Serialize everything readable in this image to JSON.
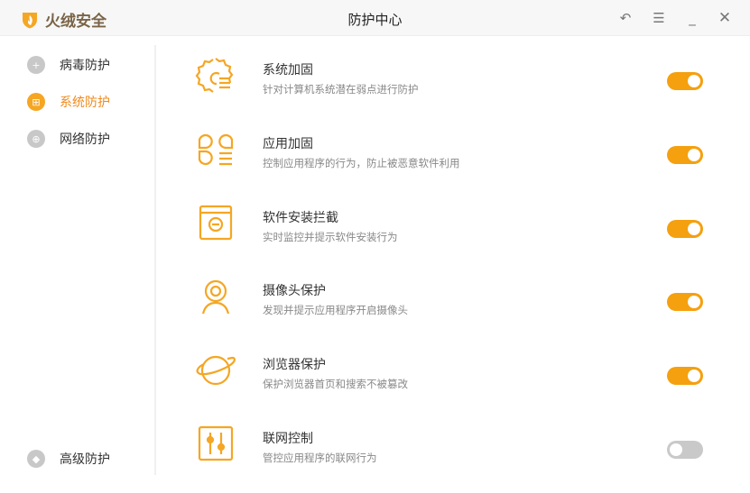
{
  "app": {
    "brand": "火绒安全",
    "title": "防护中心"
  },
  "window_controls": [
    "back-icon",
    "menu-icon",
    "minimize-icon",
    "close-icon"
  ],
  "sidebar": {
    "items": [
      {
        "label": "病毒防护",
        "icon": "plus-circle-icon",
        "active": false
      },
      {
        "label": "系统防护",
        "icon": "windows-icon",
        "active": true
      },
      {
        "label": "网络防护",
        "icon": "globe-icon",
        "active": false
      },
      {
        "label": "高级防护",
        "icon": "diamond-icon",
        "active": false
      }
    ]
  },
  "accent": "#f5a00f",
  "features": [
    {
      "title": "系统加固",
      "desc": "针对计算机系统潜在弱点进行防护",
      "enabled": true,
      "icon": "gear-shield-icon"
    },
    {
      "title": "应用加固",
      "desc": "控制应用程序的行为，防止被恶意软件利用",
      "enabled": true,
      "icon": "apps-icon"
    },
    {
      "title": "软件安装拦截",
      "desc": "实时监控并提示软件安装行为",
      "enabled": true,
      "icon": "install-block-icon"
    },
    {
      "title": "摄像头保护",
      "desc": "发现并提示应用程序开启摄像头",
      "enabled": true,
      "icon": "camera-icon"
    },
    {
      "title": "浏览器保护",
      "desc": "保护浏览器首页和搜索不被篡改",
      "enabled": true,
      "icon": "planet-icon"
    },
    {
      "title": "联网控制",
      "desc": "管控应用程序的联网行为",
      "enabled": false,
      "icon": "sliders-icon"
    }
  ]
}
